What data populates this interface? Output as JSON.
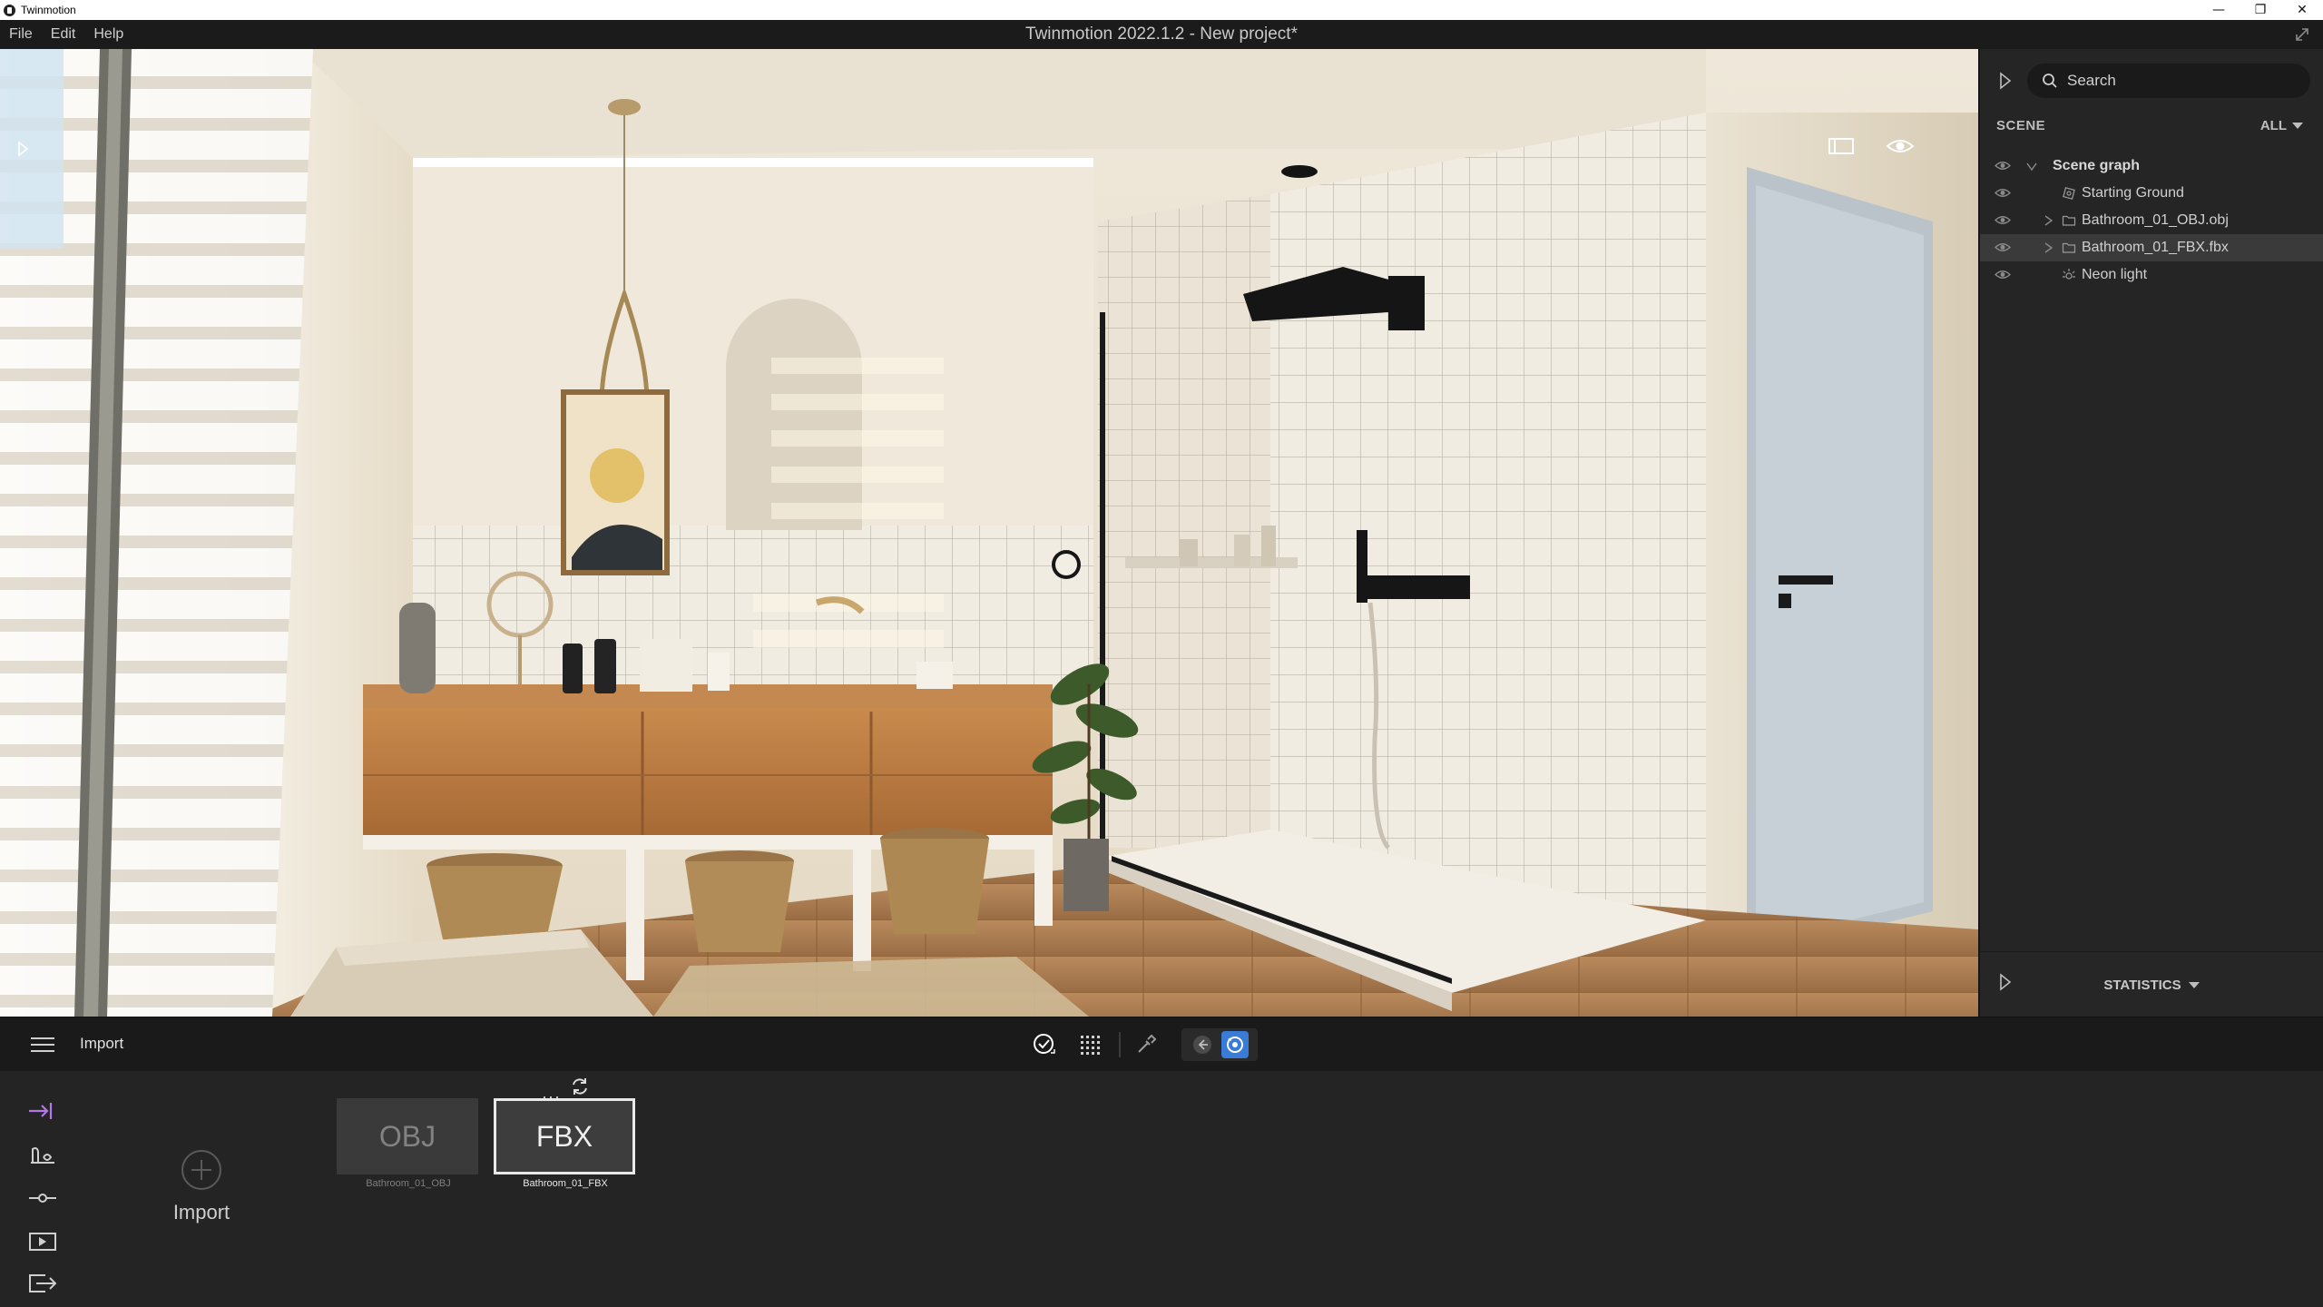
{
  "os_window": {
    "title": "Twinmotion",
    "minimize_glyph": "—",
    "maximize_glyph": "❐",
    "close_glyph": "✕"
  },
  "menubar": {
    "items": [
      "File",
      "Edit",
      "Help"
    ],
    "title": "Twinmotion 2022.1.2 - New project*"
  },
  "right_panel": {
    "search_placeholder": "Search",
    "section_label": "SCENE",
    "filter_label": "ALL",
    "tree": [
      {
        "label": "Scene graph",
        "icon": "chevron-down-icon",
        "expanded": true,
        "selected": false
      },
      {
        "label": "Starting Ground",
        "icon": "ground-icon",
        "selected": false
      },
      {
        "label": "Bathroom_01_OBJ.obj",
        "icon": "folder-icon",
        "selected": false
      },
      {
        "label": "Bathroom_01_FBX.fbx",
        "icon": "folder-icon",
        "selected": true
      },
      {
        "label": "Neon light",
        "icon": "light-icon",
        "selected": false
      }
    ],
    "statistics_label": "STATISTICS"
  },
  "toolbar": {
    "title": "Import",
    "accent_color": "#b277e6",
    "nav_active_color": "#3a7bd5"
  },
  "bottom_panel": {
    "import_label": "Import",
    "card_more": "···",
    "assets": [
      {
        "thumb_label": "OBJ",
        "name": "Bathroom_01_OBJ",
        "active": false
      },
      {
        "thumb_label": "FBX",
        "name": "Bathroom_01_FBX",
        "active": true
      }
    ]
  }
}
